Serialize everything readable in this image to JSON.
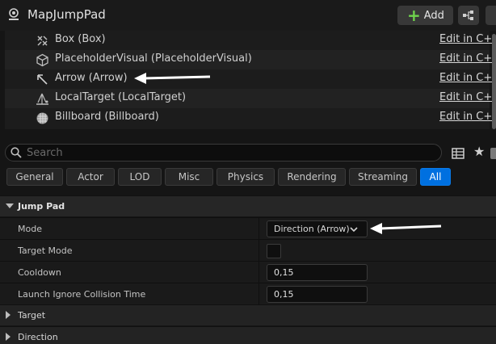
{
  "header": {
    "title": "MapJumpPad",
    "add_label": "Add",
    "actor_icon": "actor-icon",
    "blueprint_icon": "blueprint-hierarchy-icon"
  },
  "components": [
    {
      "name": "Box (Box)",
      "icon": "box-collision-icon",
      "edit": "Edit in C++"
    },
    {
      "name": "PlaceholderVisual (PlaceholderVisual)",
      "icon": "cube-mesh-icon",
      "edit": "Edit in C++"
    },
    {
      "name": "Arrow (Arrow)",
      "icon": "arrow-component-icon",
      "edit": "Edit in C++"
    },
    {
      "name": "LocalTarget (LocalTarget)",
      "icon": "scene-target-icon",
      "edit": "Edit in C++"
    },
    {
      "name": "Billboard (Billboard)",
      "icon": "billboard-icon",
      "edit": "Edit in C++"
    }
  ],
  "search": {
    "placeholder": "Search"
  },
  "filters": [
    "General",
    "Actor",
    "LOD",
    "Misc",
    "Physics",
    "Rendering",
    "Streaming",
    "All"
  ],
  "active_filter": "All",
  "jump_pad": {
    "category": "Jump Pad",
    "mode_label": "Mode",
    "mode_value": "Direction (Arrow)",
    "target_mode_label": "Target Mode",
    "target_mode_checked": false,
    "cooldown_label": "Cooldown",
    "cooldown_value": "0,15",
    "launch_label": "Launch Ignore Collision Time",
    "launch_value": "0,15"
  },
  "collapsed_categories": [
    "Target",
    "Direction"
  ],
  "colors": {
    "accent": "#0070e0",
    "add_plus": "#6fd34d",
    "annotation_arrow": "#ffffff"
  }
}
